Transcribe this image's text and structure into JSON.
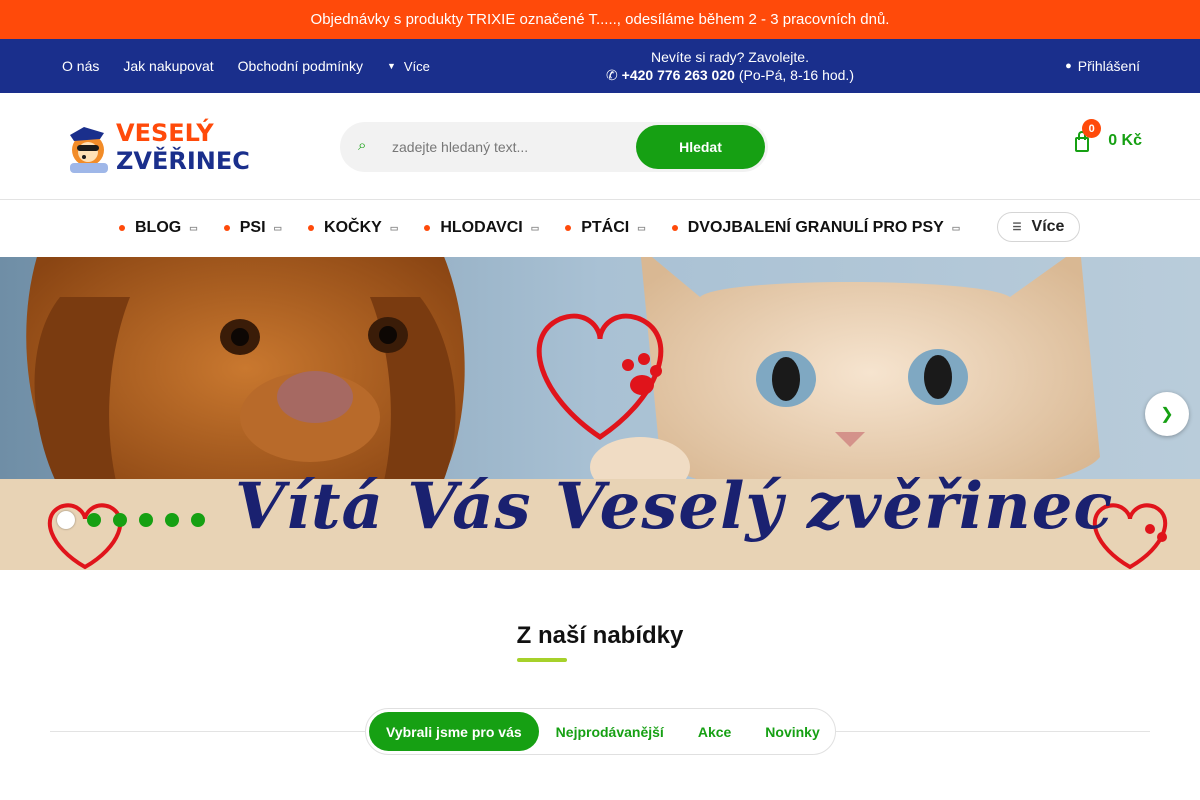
{
  "announcement": "Objednávky s produkty TRIXIE označené T....., odesíláme během 2 - 3 pracovních dnů.",
  "topnav": {
    "links": [
      "O nás",
      "Jak nakupovat",
      "Obchodní podmínky"
    ],
    "more_label": "Více",
    "more_icon": "chevron-down-icon",
    "help_line": "Nevíte si rady? Zavolejte.",
    "phone": "+420 776 263 020",
    "phone_hours": "(Po-Pá, 8-16 hod.)",
    "phone_icon": "phone-icon",
    "login_label": "Přihlášení",
    "login_icon": "user-icon"
  },
  "header": {
    "logo_line1": "VESELÝ",
    "logo_line2": "ZVĚŘINEC",
    "search_placeholder": "zadejte hledaný text...",
    "search_button": "Hledat",
    "search_icon": "search-icon",
    "cart_count": "0",
    "cart_total": "0 Kč",
    "cart_icon": "shopping-bag-icon"
  },
  "categories": {
    "items": [
      "BLOG",
      "PSI",
      "KOČKY",
      "HLODAVCI",
      "PTÁCI",
      "DVOJBALENÍ GRANULÍ PRO PSY"
    ],
    "more_label": "Více"
  },
  "banner": {
    "caption": "Vítá Vás Veselý zvěřinec",
    "slide_count": 6,
    "active_slide": 1
  },
  "offer": {
    "title": "Z naší nabídky",
    "tabs": [
      "Vybrali jsme pro vás",
      "Nejprodávanější",
      "Akce",
      "Novinky"
    ],
    "active_tab": 0
  },
  "colors": {
    "announcement_bg": "#ff4a0a",
    "topnav_bg": "#1a2f8c",
    "accent_green": "#16a013",
    "underline_lime": "#a6d12a"
  }
}
